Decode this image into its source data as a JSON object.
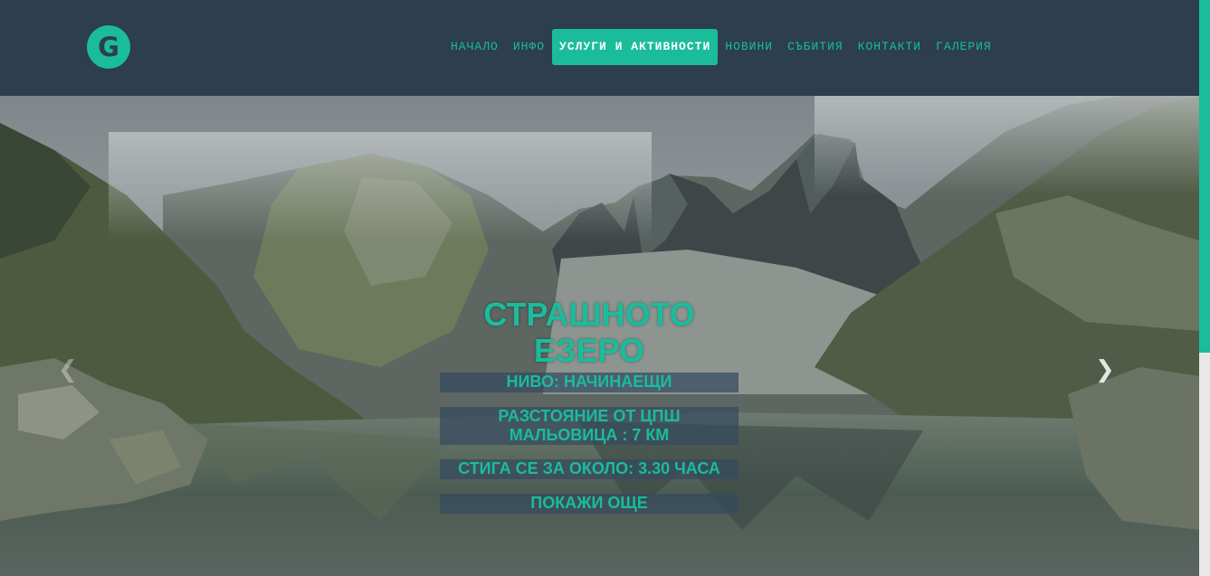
{
  "logo": {
    "letter": "G"
  },
  "nav": {
    "items": [
      {
        "label": "НАЧАЛО"
      },
      {
        "label": "ИНФО"
      },
      {
        "label": "УСЛУГИ И АКТИВНОСТИ",
        "active": true
      },
      {
        "label": "НОВИНИ"
      },
      {
        "label": "СЪБИТИЯ"
      },
      {
        "label": "КОНТАКТИ"
      },
      {
        "label": "ГАЛЕРИЯ"
      }
    ]
  },
  "slide": {
    "title_line1": "СТРАШНОТО",
    "title_line2": "ЕЗЕРО",
    "level": "НИВО: НАЧИНАЕЩИ",
    "distance_line1": "РАЗСТОЯНИЕ ОТ ЦПШ",
    "distance_line2": "МАЛЬОВИЦА : 7 КМ",
    "time": "СТИГА СЕ ЗА ОКОЛО: 3.30 ЧАСА",
    "more": "ПОКАЖИ ОЩЕ"
  },
  "carousel": {
    "prev_icon": "chevron-left-icon",
    "next_icon": "chevron-right-icon"
  },
  "colors": {
    "accent": "#1abc9c",
    "header_bg": "#2c3e50",
    "caption_bg": "#34495e"
  }
}
